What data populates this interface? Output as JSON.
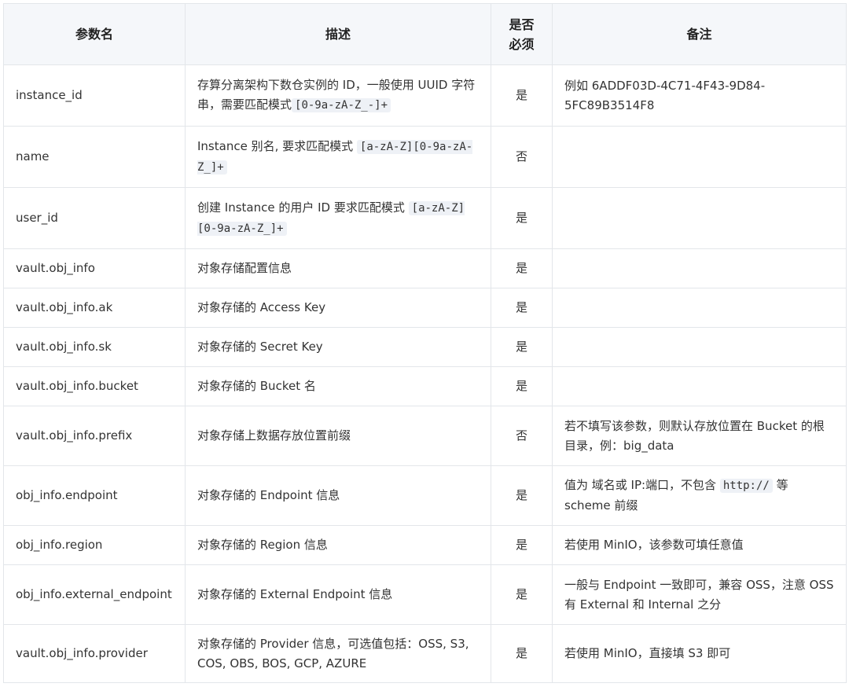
{
  "headers": {
    "name": "参数名",
    "desc": "描述",
    "required": "是否必须",
    "note": "备注"
  },
  "rows": [
    {
      "name": "instance_id",
      "desc": "存算分离架构下数仓实例的 ID，一般使用 UUID 字符串，需要匹配模式",
      "desc_code": "[0-9a-zA-Z_-]+",
      "required": "是",
      "note": "例如 6ADDF03D-4C71-4F43-9D84-5FC89B3514F8"
    },
    {
      "name": "name",
      "desc": "Instance 别名, 要求匹配模式",
      "desc_code": "[a-zA-Z][0-9a-zA-Z_]+",
      "required": "否",
      "note": ""
    },
    {
      "name": "user_id",
      "desc": "创建 Instance 的用户 ID 要求匹配模式",
      "desc_code": "[a-zA-Z][0-9a-zA-Z_]+",
      "required": "是",
      "note": ""
    },
    {
      "name": "vault.obj_info",
      "desc": "对象存储配置信息",
      "required": "是",
      "note": ""
    },
    {
      "name": "vault.obj_info.ak",
      "desc": "对象存储的 Access Key",
      "required": "是",
      "note": ""
    },
    {
      "name": "vault.obj_info.sk",
      "desc": "对象存储的 Secret Key",
      "required": "是",
      "note": ""
    },
    {
      "name": "vault.obj_info.bucket",
      "desc": "对象存储的 Bucket 名",
      "required": "是",
      "note": ""
    },
    {
      "name": "vault.obj_info.prefix",
      "desc": "对象存储上数据存放位置前缀",
      "required": "否",
      "note": "若不填写该参数，则默认存放位置在 Bucket 的根目录，例：big_data"
    },
    {
      "name": "obj_info.endpoint",
      "desc": "对象存储的 Endpoint 信息",
      "required": "是",
      "note": "值为 域名或 IP:端口，不包含",
      "note_code": "http://",
      "note_tail": "等 scheme 前缀"
    },
    {
      "name": "obj_info.region",
      "desc": "对象存储的 Region 信息",
      "required": "是",
      "note": "若使用 MinIO，该参数可填任意值"
    },
    {
      "name": "obj_info.external_endpoint",
      "desc": "对象存储的 External Endpoint 信息",
      "required": "是",
      "note": "一般与 Endpoint 一致即可，兼容 OSS，注意 OSS 有 External 和 Internal 之分"
    },
    {
      "name": "vault.obj_info.provider",
      "desc": "对象存储的 Provider 信息，可选值包括：OSS, S3, COS, OBS, BOS, GCP, AZURE",
      "required": "是",
      "note": "若使用 MinIO，直接填 S3 即可"
    }
  ]
}
